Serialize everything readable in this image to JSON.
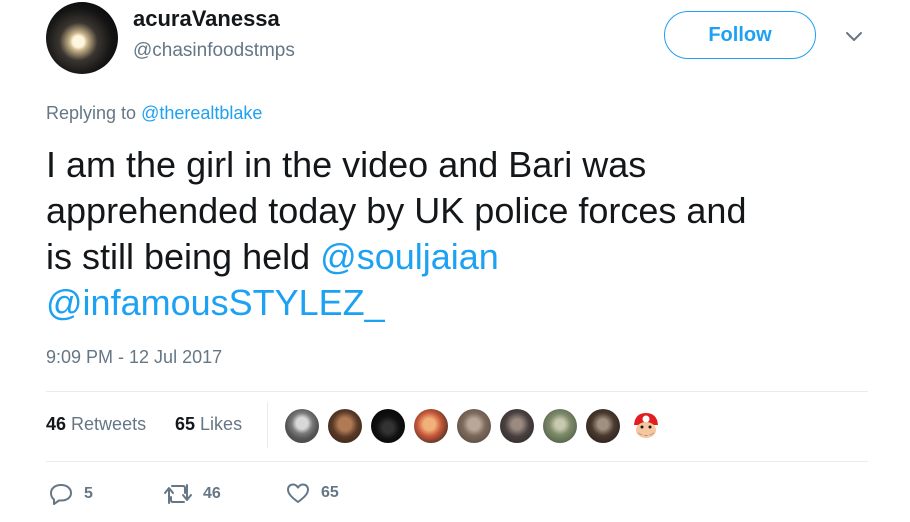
{
  "author": {
    "display_name": "acuraVanessa",
    "handle": "@chasinfoodstmps",
    "avatar_icon": "profile-photo"
  },
  "follow_label": "Follow",
  "reply_context": {
    "prefix": "Replying to",
    "mention": "@therealtblake"
  },
  "tweet": {
    "line1": "I am the girl in the video and Bari was",
    "line2": "apprehended today by UK police forces and",
    "line3_text": "is still being held ",
    "mention1": "@souljaian",
    "mention2": "@infamousSTYLEZ_"
  },
  "timestamp": "9:09 PM - 12 Jul 2017",
  "stats": {
    "retweets_count": "46",
    "retweets_label": "Retweets",
    "likes_count": "65",
    "likes_label": "Likes"
  },
  "likers": [
    "liker-avatar-1",
    "liker-avatar-2",
    "liker-avatar-3",
    "liker-avatar-4",
    "liker-avatar-5",
    "liker-avatar-6",
    "liker-avatar-7",
    "liker-avatar-8",
    "liker-avatar-9"
  ],
  "actions": {
    "reply_count": "5",
    "retweet_count": "46",
    "like_count": "65"
  },
  "colors": {
    "accent": "#1da1f2",
    "secondary_text": "#657786",
    "primary_text": "#14171a",
    "divider": "#e6ecf0"
  }
}
